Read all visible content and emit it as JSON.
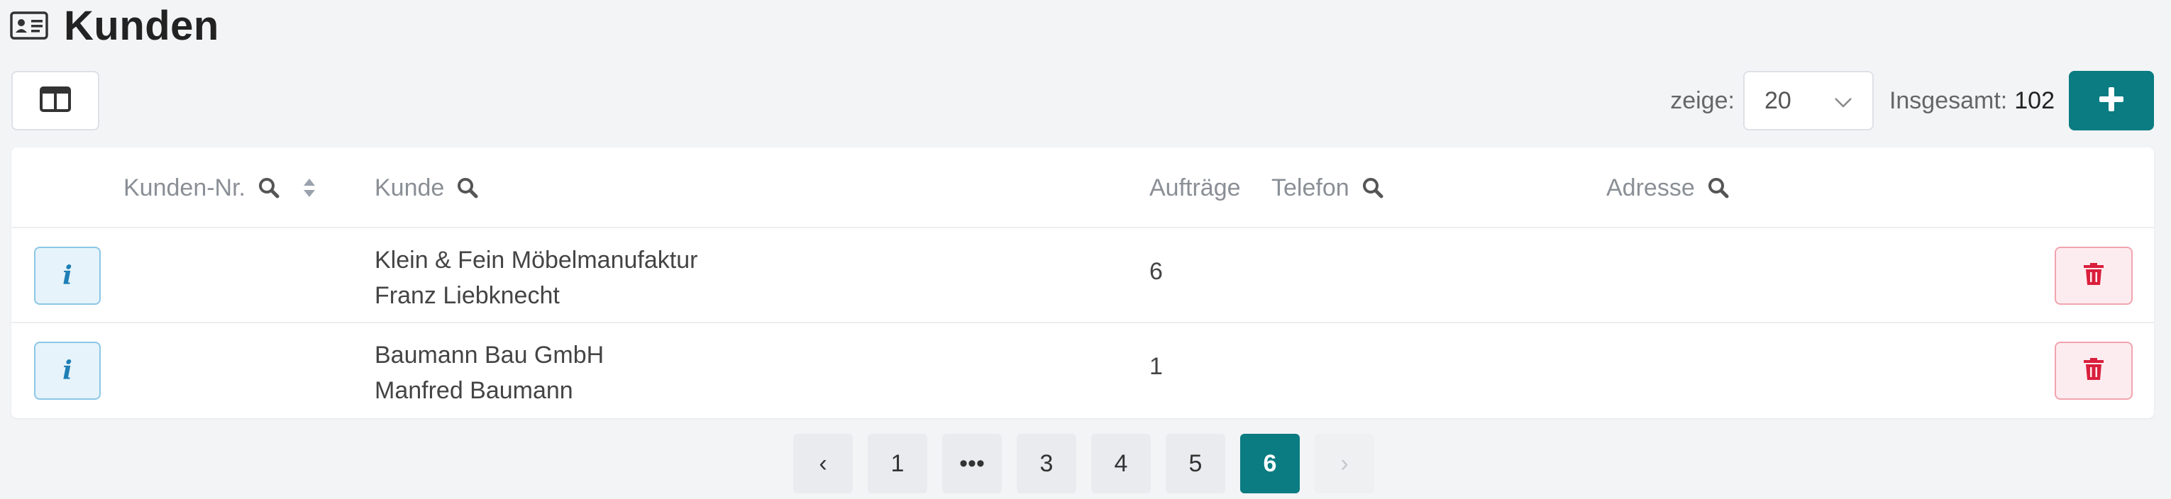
{
  "header": {
    "title": "Kunden",
    "icon": "contact-card-icon"
  },
  "toolbar": {
    "columns_icon": "columns-icon",
    "show_label": "zeige:",
    "page_size": "20",
    "total_label": "Insgesamt:",
    "total_value": "102",
    "add_icon": "plus-icon",
    "accent_color": "#0a7c82"
  },
  "table": {
    "columns": {
      "customer_no": "Kunden-Nr.",
      "customer": "Kunde",
      "orders": "Aufträge",
      "phone": "Telefon",
      "address": "Adresse"
    },
    "rows": [
      {
        "company": "Klein & Fein Möbelmanufaktur",
        "contact": "Franz Liebknecht",
        "orders": "6",
        "phone": "",
        "address": ""
      },
      {
        "company": "Baumann Bau GmbH",
        "contact": "Manfred Baumann",
        "orders": "1",
        "phone": "",
        "address": ""
      }
    ]
  },
  "pagination": {
    "prev": "‹",
    "pages": [
      "1",
      "•••",
      "3",
      "4",
      "5",
      "6"
    ],
    "current": "6",
    "next": "›"
  }
}
